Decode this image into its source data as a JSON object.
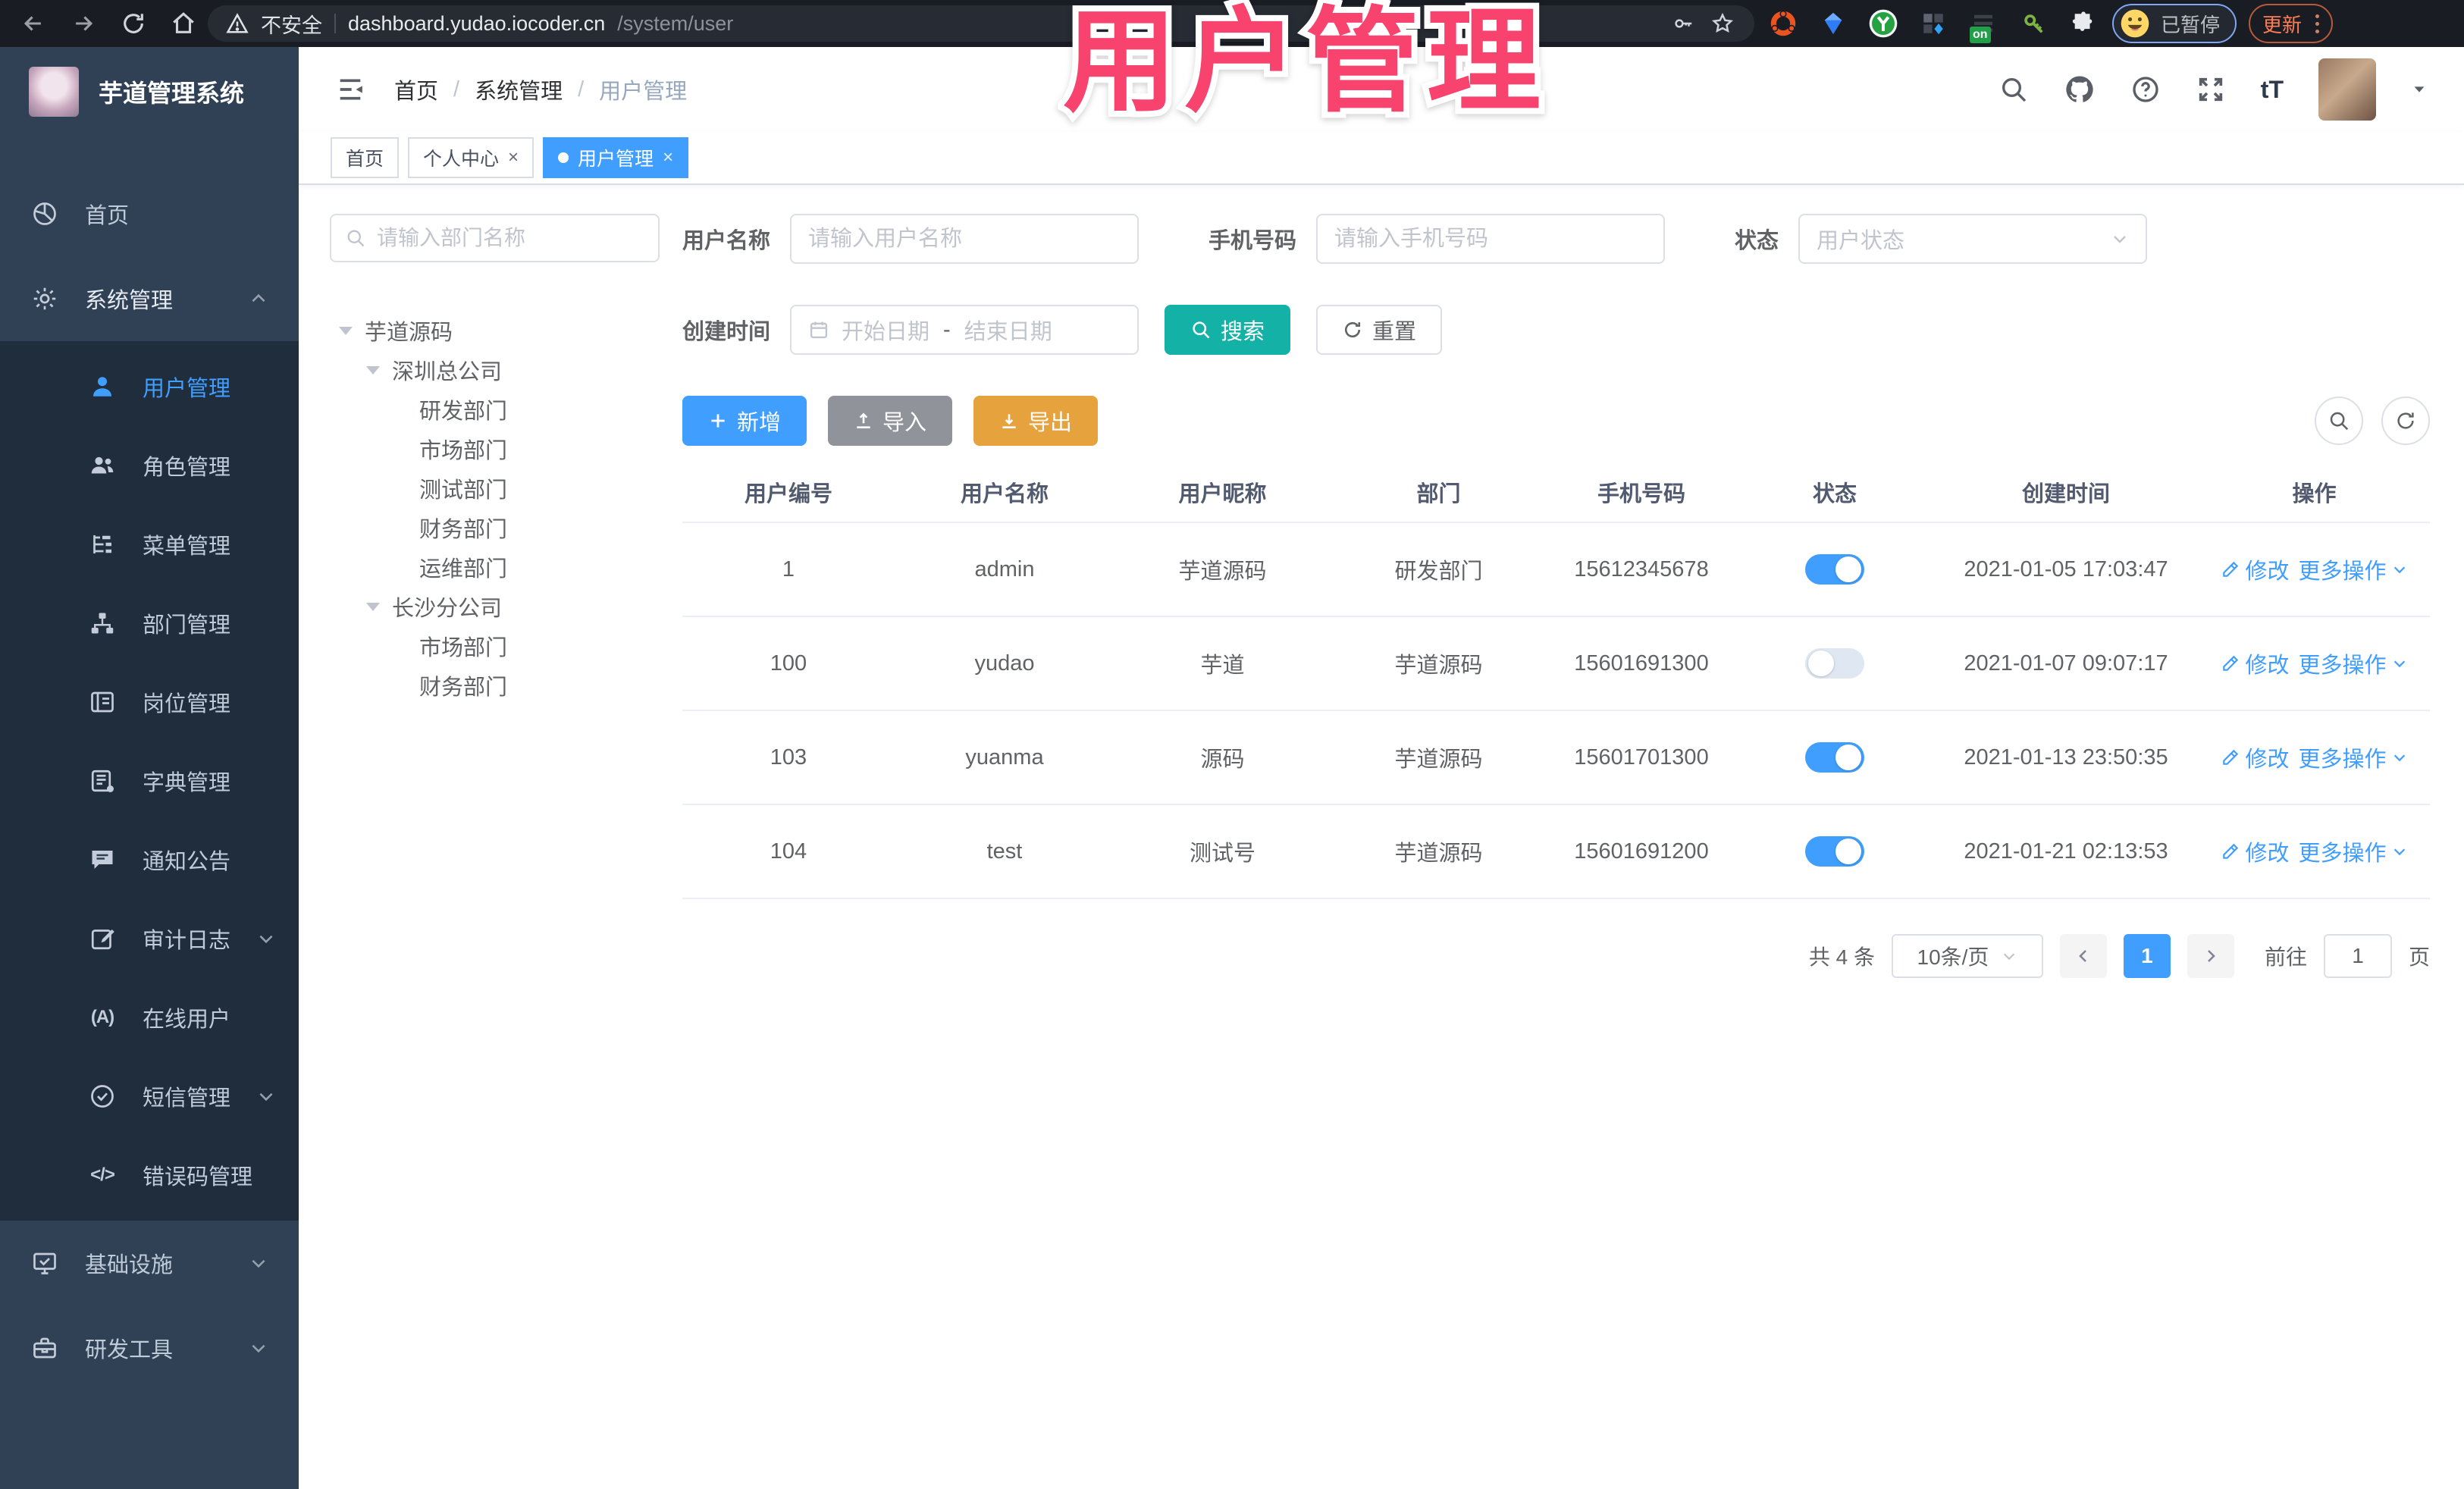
{
  "colors": {
    "accent": "#409eff",
    "teal": "#13b1a6",
    "pink": "#f8436e",
    "sidebar": "#304156",
    "submenu": "#1f2d3d",
    "browserbar": "#191c22",
    "warning": "#e6a23c",
    "info": "#909399"
  },
  "overlay": {
    "title": "用户管理"
  },
  "browser": {
    "security_label": "不安全",
    "url_host": "dashboard.yudao.iocoder.cn",
    "url_path": "/system/user",
    "profile_status": "已暂停",
    "update_label": "更新",
    "extension_badge": "on"
  },
  "sidebar": {
    "logo_title": "芋道管理系统",
    "home_label": "首页",
    "system_label": "系统管理",
    "system_children": [
      "用户管理",
      "角色管理",
      "菜单管理",
      "部门管理",
      "岗位管理",
      "字典管理",
      "通知公告",
      "审计日志",
      "在线用户",
      "短信管理",
      "错误码管理"
    ],
    "infra_label": "基础设施",
    "devtools_label": "研发工具"
  },
  "header": {
    "separator": "/",
    "breadcrumb": [
      "首页",
      "系统管理",
      "用户管理"
    ]
  },
  "tabs": [
    {
      "label": "首页"
    },
    {
      "label": "个人中心"
    },
    {
      "label": "用户管理"
    }
  ],
  "tree": {
    "search_placeholder": "请输入部门名称",
    "root": "芋道源码",
    "branch1": "深圳总公司",
    "branch1_children": [
      "研发部门",
      "市场部门",
      "测试部门",
      "财务部门",
      "运维部门"
    ],
    "branch2": "长沙分公司",
    "branch2_children": [
      "市场部门",
      "财务部门"
    ]
  },
  "filters": {
    "username_label": "用户名称",
    "username_placeholder": "请输入用户名称",
    "mobile_label": "手机号码",
    "mobile_placeholder": "请输入手机号码",
    "status_label": "状态",
    "status_placeholder": "用户状态",
    "created_label": "创建时间",
    "date_start_placeholder": "开始日期",
    "date_separator": "-",
    "date_end_placeholder": "结束日期",
    "search_label": "搜索",
    "reset_label": "重置"
  },
  "toolbar": {
    "add_label": "新增",
    "import_label": "导入",
    "export_label": "导出"
  },
  "table": {
    "columns": [
      "用户编号",
      "用户名称",
      "用户昵称",
      "部门",
      "手机号码",
      "状态",
      "创建时间",
      "操作"
    ],
    "actions": {
      "edit": "修改",
      "more": "更多操作"
    },
    "rows": [
      {
        "id": "1",
        "username": "admin",
        "nickname": "芋道源码",
        "dept": "研发部门",
        "mobile": "15612345678",
        "status_on": true,
        "created": "2021-01-05 17:03:47"
      },
      {
        "id": "100",
        "username": "yudao",
        "nickname": "芋道",
        "dept": "芋道源码",
        "mobile": "15601691300",
        "status_on": false,
        "created": "2021-01-07 09:07:17"
      },
      {
        "id": "103",
        "username": "yuanma",
        "nickname": "源码",
        "dept": "芋道源码",
        "mobile": "15601701300",
        "status_on": true,
        "created": "2021-01-13 23:50:35"
      },
      {
        "id": "104",
        "username": "test",
        "nickname": "测试号",
        "dept": "芋道源码",
        "mobile": "15601691200",
        "status_on": true,
        "created": "2021-01-21 02:13:53"
      }
    ]
  },
  "pagination": {
    "total_label": "共 4 条",
    "page_size_label": "10条/页",
    "current_page": "1",
    "goto_label": "前往",
    "goto_value": "1",
    "page_unit_label": "页"
  }
}
